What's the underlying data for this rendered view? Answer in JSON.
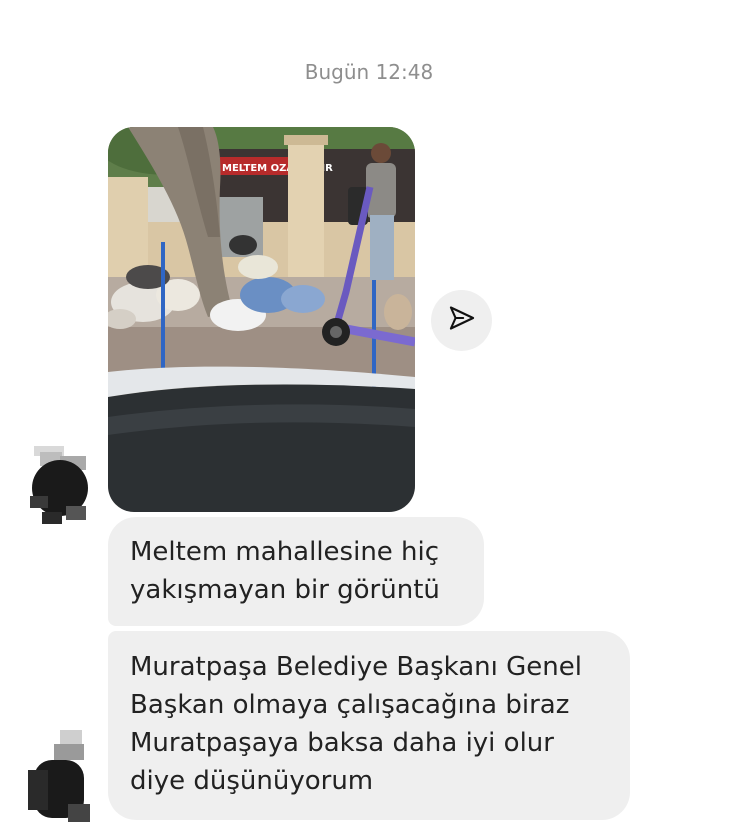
{
  "timestamp": "Bugün 12:48",
  "photo": {
    "storefront_sign": "MELTEM  OZALIT-KIR"
  },
  "share_button": {
    "icon": "send-icon"
  },
  "messages": [
    {
      "text": "Meltem mahallesine hiç\nyakışmayan bir görüntü"
    },
    {
      "text": "Muratpaşa Belediye Başkanı Genel\nBaşkan olmaya çalışacağına biraz\nMuratpaşaya baksa daha iyi olur\ndiye düşünüyorum"
    }
  ],
  "colors": {
    "bubble_background": "#efefef",
    "timestamp_text": "#8e8e8e",
    "message_text": "#222222"
  }
}
